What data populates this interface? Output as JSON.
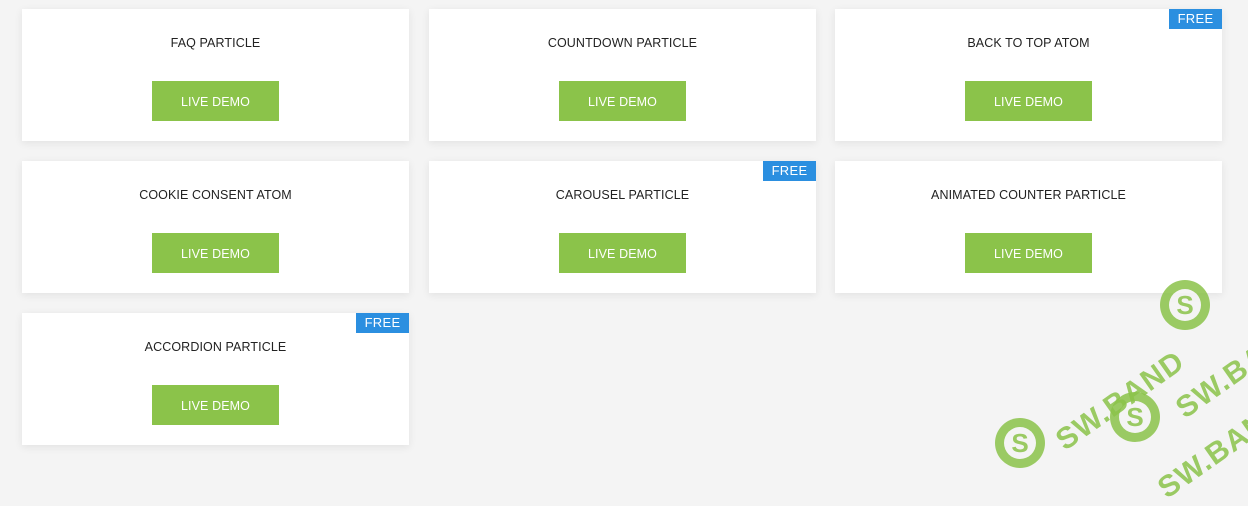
{
  "cards": [
    {
      "title": "FAQ PARTICLE",
      "button": "LIVE DEMO",
      "badge": ""
    },
    {
      "title": "COUNTDOWN PARTICLE",
      "button": "LIVE DEMO",
      "badge": ""
    },
    {
      "title": "BACK TO TOP ATOM",
      "button": "LIVE DEMO",
      "badge": "FREE"
    },
    {
      "title": "COOKIE CONSENT ATOM",
      "button": "LIVE DEMO",
      "badge": ""
    },
    {
      "title": "CAROUSEL PARTICLE",
      "button": "LIVE DEMO",
      "badge": "FREE"
    },
    {
      "title": "ANIMATED COUNTER PARTICLE",
      "button": "LIVE DEMO",
      "badge": ""
    },
    {
      "title": "ACCORDION PARTICLE",
      "button": "LIVE DEMO",
      "badge": "FREE"
    }
  ],
  "watermark": {
    "text": "SW.BAND",
    "logo_letter": "S"
  },
  "colors": {
    "button": "#8bc34a",
    "badge": "#2b8fe0",
    "background": "#f4f4f4",
    "card": "#ffffff"
  }
}
